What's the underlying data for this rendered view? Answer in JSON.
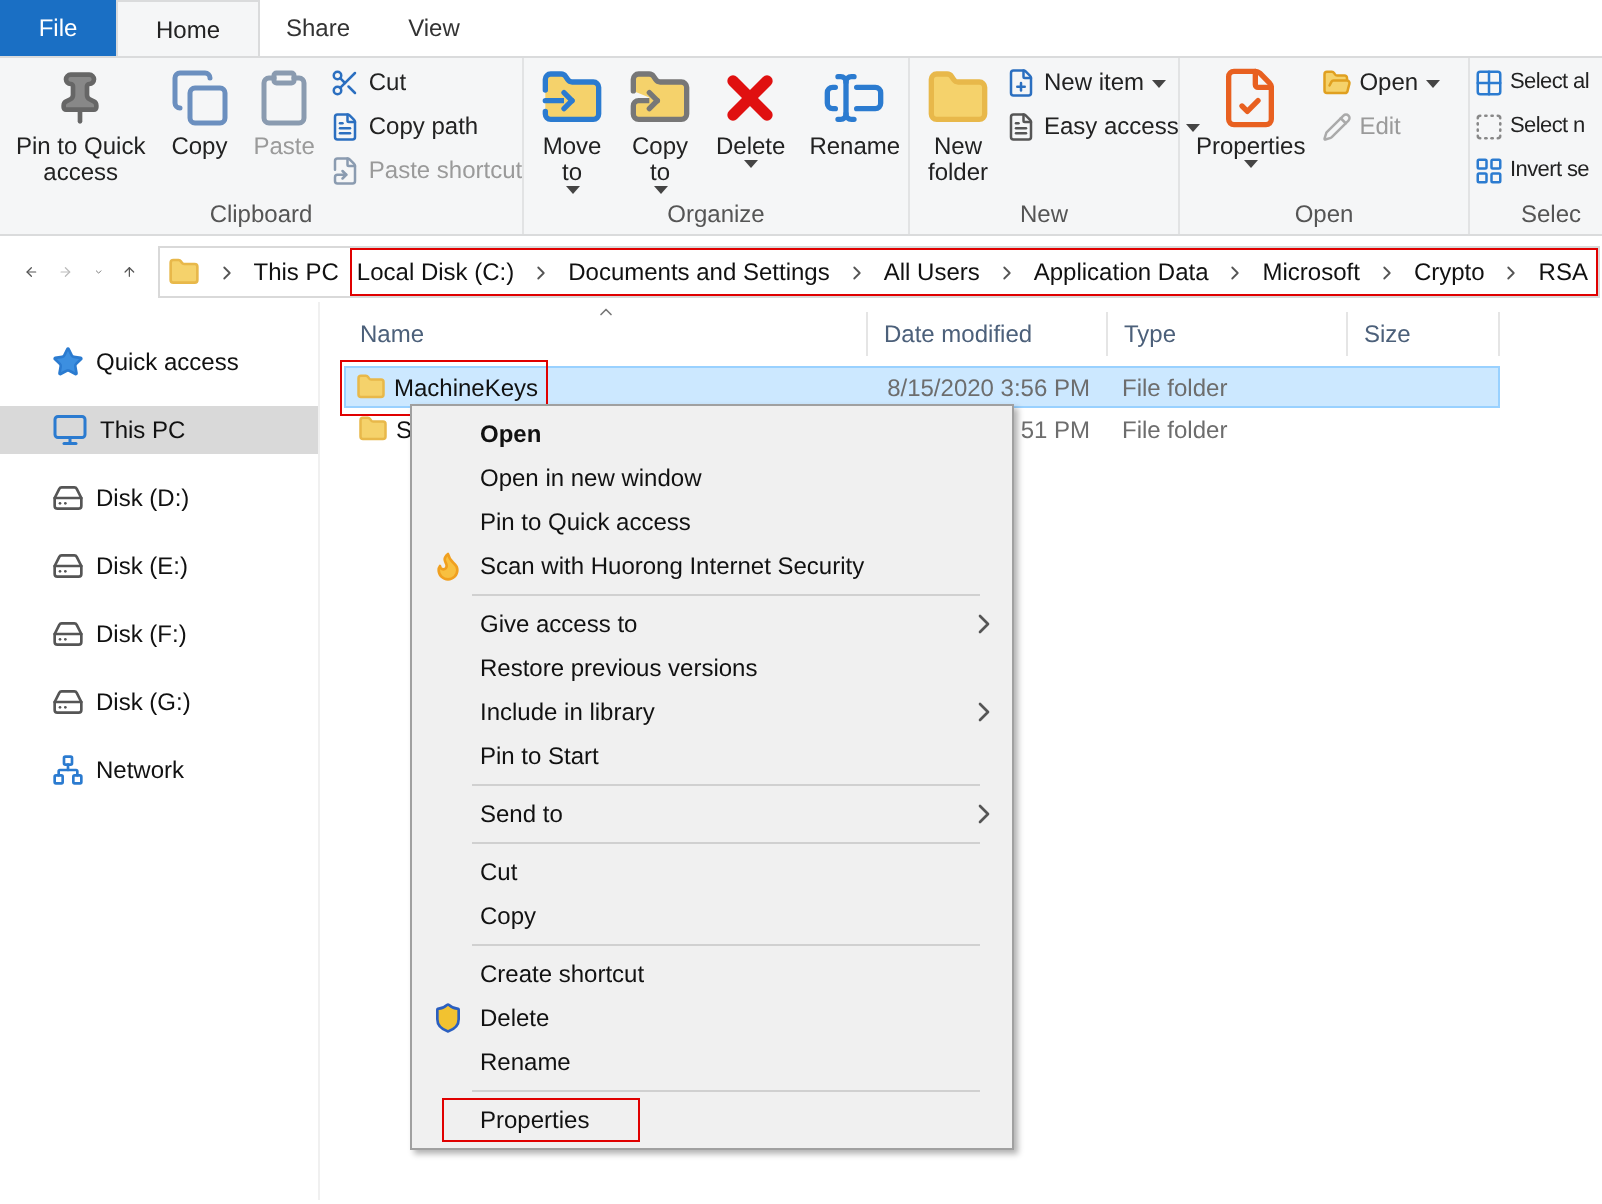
{
  "tabs": [
    {
      "label": "File",
      "kind": "file",
      "selected": false
    },
    {
      "label": "Home",
      "kind": "tab",
      "selected": true
    },
    {
      "label": "Share",
      "kind": "tab",
      "selected": false
    },
    {
      "label": "View",
      "kind": "tab",
      "selected": false
    }
  ],
  "ribbon": [
    {
      "label": "Clipboard",
      "items": [
        {
          "kind": "large",
          "label": "Pin to Quick\naccess",
          "disabled": false,
          "dropdown": false
        },
        {
          "kind": "large",
          "label": "Copy",
          "disabled": false,
          "dropdown": false
        },
        {
          "kind": "large",
          "label": "Paste",
          "disabled": true,
          "dropdown": false
        },
        {
          "kind": "stack",
          "items": [
            {
              "label": "Cut",
              "disabled": false,
              "dropdown": false
            },
            {
              "label": "Copy path",
              "disabled": false,
              "dropdown": false
            },
            {
              "label": "Paste shortcut",
              "disabled": true,
              "dropdown": false
            }
          ]
        }
      ]
    },
    {
      "label": "Organize",
      "items": [
        {
          "kind": "large",
          "label": "Move\nto",
          "disabled": false,
          "dropdown": true
        },
        {
          "kind": "large",
          "label": "Copy\nto",
          "disabled": false,
          "dropdown": true
        },
        {
          "kind": "large",
          "label": "Delete",
          "disabled": false,
          "dropdown": true
        },
        {
          "kind": "large",
          "label": "Rename",
          "disabled": false,
          "dropdown": false
        }
      ]
    },
    {
      "label": "New",
      "items": [
        {
          "kind": "large",
          "label": "New\nfolder",
          "disabled": false,
          "dropdown": false
        },
        {
          "kind": "stack",
          "items": [
            {
              "label": "New item",
              "disabled": false,
              "dropdown": true
            },
            {
              "label": "Easy access",
              "disabled": false,
              "dropdown": true
            }
          ]
        }
      ]
    },
    {
      "label": "Open",
      "items": [
        {
          "kind": "large",
          "label": "Properties",
          "disabled": false,
          "dropdown": true
        },
        {
          "kind": "stack",
          "items": [
            {
              "label": "Open",
              "disabled": false,
              "dropdown": true
            },
            {
              "label": "Edit",
              "disabled": true,
              "dropdown": false
            }
          ]
        }
      ]
    },
    {
      "label": "Selec",
      "items": [
        {
          "kind": "stack",
          "items": [
            {
              "label": "Select al",
              "disabled": false,
              "dropdown": false
            },
            {
              "label": "Select n",
              "disabled": false,
              "dropdown": false
            },
            {
              "label": "Invert se",
              "disabled": false,
              "dropdown": false
            }
          ]
        }
      ]
    }
  ],
  "address": {
    "crumbs": [
      "This PC"
    ],
    "framed_crumbs": [
      "Local Disk (C:)",
      "Documents and Settings",
      "All Users",
      "Application Data",
      "Microsoft",
      "Crypto",
      "RSA"
    ]
  },
  "sidebar": {
    "items": [
      {
        "label": "Quick access",
        "kind": "quick",
        "selected": false
      },
      {
        "label": "This PC",
        "kind": "pc",
        "selected": true
      },
      {
        "label": "Disk (D:)",
        "kind": "disk",
        "selected": false
      },
      {
        "label": "Disk (E:)",
        "kind": "disk",
        "selected": false
      },
      {
        "label": "Disk (F:)",
        "kind": "disk",
        "selected": false
      },
      {
        "label": "Disk (G:)",
        "kind": "disk",
        "selected": false
      },
      {
        "label": "Network",
        "kind": "network",
        "selected": false
      }
    ]
  },
  "table": {
    "columns": [
      "Name",
      "Date modified",
      "Type",
      "Size"
    ],
    "rows": [
      {
        "name": "MachineKeys",
        "date": "8/15/2020 3:56 PM",
        "type": "File folder",
        "selected": true,
        "highlighted": true
      },
      {
        "name": "S",
        "date": "51 PM",
        "type": "File folder",
        "selected": false,
        "highlighted": false
      }
    ]
  },
  "context_menu": {
    "groups": [
      [
        {
          "label": "Open",
          "kind": "plain",
          "default": true,
          "submenu": false,
          "highlighted": false
        },
        {
          "label": "Open in new window",
          "kind": "plain",
          "default": false,
          "submenu": false,
          "highlighted": false
        },
        {
          "label": "Pin to Quick access",
          "kind": "plain",
          "default": false,
          "submenu": false,
          "highlighted": false
        },
        {
          "label": "Scan with Huorong Internet Security",
          "kind": "scan",
          "default": false,
          "submenu": false,
          "highlighted": false
        }
      ],
      [
        {
          "label": "Give access to",
          "kind": "plain",
          "default": false,
          "submenu": true,
          "highlighted": false
        },
        {
          "label": "Restore previous versions",
          "kind": "plain",
          "default": false,
          "submenu": false,
          "highlighted": false
        },
        {
          "label": "Include in library",
          "kind": "plain",
          "default": false,
          "submenu": true,
          "highlighted": false
        },
        {
          "label": "Pin to Start",
          "kind": "plain",
          "default": false,
          "submenu": false,
          "highlighted": false
        }
      ],
      [
        {
          "label": "Send to",
          "kind": "plain",
          "default": false,
          "submenu": true,
          "highlighted": false
        }
      ],
      [
        {
          "label": "Cut",
          "kind": "plain",
          "default": false,
          "submenu": false,
          "highlighted": false
        },
        {
          "label": "Copy",
          "kind": "plain",
          "default": false,
          "submenu": false,
          "highlighted": false
        }
      ],
      [
        {
          "label": "Create shortcut",
          "kind": "plain",
          "default": false,
          "submenu": false,
          "highlighted": false
        },
        {
          "label": "Delete",
          "kind": "admin",
          "default": false,
          "submenu": false,
          "highlighted": false
        },
        {
          "label": "Rename",
          "kind": "plain",
          "default": false,
          "submenu": false,
          "highlighted": false
        }
      ],
      [
        {
          "label": "Properties",
          "kind": "plain",
          "default": false,
          "submenu": false,
          "highlighted": true
        }
      ]
    ]
  }
}
